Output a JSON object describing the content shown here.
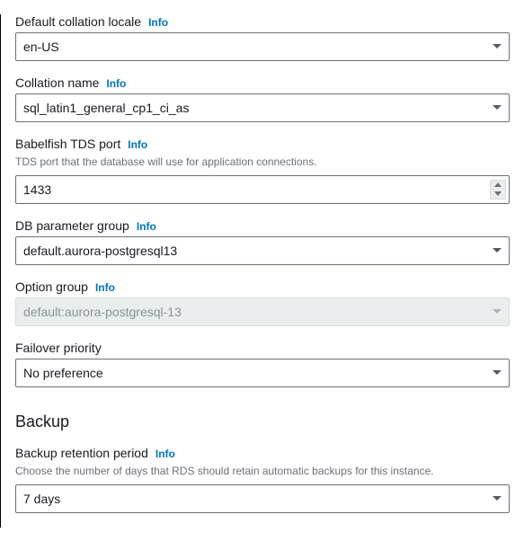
{
  "info_label": "Info",
  "fields": {
    "collation_locale": {
      "label": "Default collation locale",
      "value": "en-US"
    },
    "collation_name": {
      "label": "Collation name",
      "value": "sql_latin1_general_cp1_ci_as"
    },
    "tds_port": {
      "label": "Babelfish TDS port",
      "description": "TDS port that the database will use for application connections.",
      "value": "1433"
    },
    "db_parameter_group": {
      "label": "DB parameter group",
      "value": "default.aurora-postgresql13"
    },
    "option_group": {
      "label": "Option group",
      "value": "default:aurora-postgresql-13"
    },
    "failover_priority": {
      "label": "Failover priority",
      "value": "No preference"
    },
    "backup_retention": {
      "label": "Backup retention period",
      "description": "Choose the number of days that RDS should retain automatic backups for this instance.",
      "value": "7 days"
    }
  },
  "sections": {
    "backup": "Backup"
  }
}
